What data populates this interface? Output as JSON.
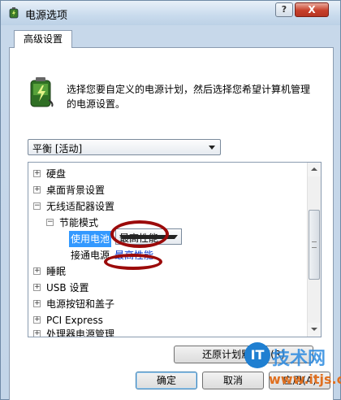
{
  "window": {
    "title": "电源选项",
    "help_label": "?",
    "close_label": "X"
  },
  "tabs": [
    {
      "label": "高级设置"
    }
  ],
  "description": "选择您要自定义的电源计划，然后选择您希望计算机管理的电源设置。",
  "plan_select": {
    "value": "平衡 [活动]"
  },
  "tree": {
    "items": [
      {
        "label": "硬盘",
        "expander": "+"
      },
      {
        "label": "桌面背景设置",
        "expander": "+"
      },
      {
        "label": "无线适配器设置",
        "expander": "−"
      },
      {
        "label": "节能模式",
        "expander": "−"
      },
      {
        "label": "使用电池",
        "selected": true
      },
      {
        "label": "接通电源"
      },
      {
        "label": "睡眠",
        "expander": "+"
      },
      {
        "label": "USB 设置",
        "expander": "+"
      },
      {
        "label": "电源按钮和盖子",
        "expander": "+"
      },
      {
        "label": "PCI Express",
        "expander": "+"
      },
      {
        "label": "处理器电源管理",
        "expander": "+"
      }
    ],
    "battery_value": "最高性能",
    "plugged_value": "最高性能"
  },
  "restore_button": "还原计划默认值(R)",
  "buttons": {
    "ok": "确定",
    "cancel": "取消",
    "apply": "应用(A)"
  },
  "watermark": {
    "logo": "IT",
    "name": "技术网",
    "url": "www.itjs.cn"
  },
  "colors": {
    "selection": "#3399ff",
    "annotation_ring": "#9b0a0a",
    "link": "#0033cc"
  }
}
